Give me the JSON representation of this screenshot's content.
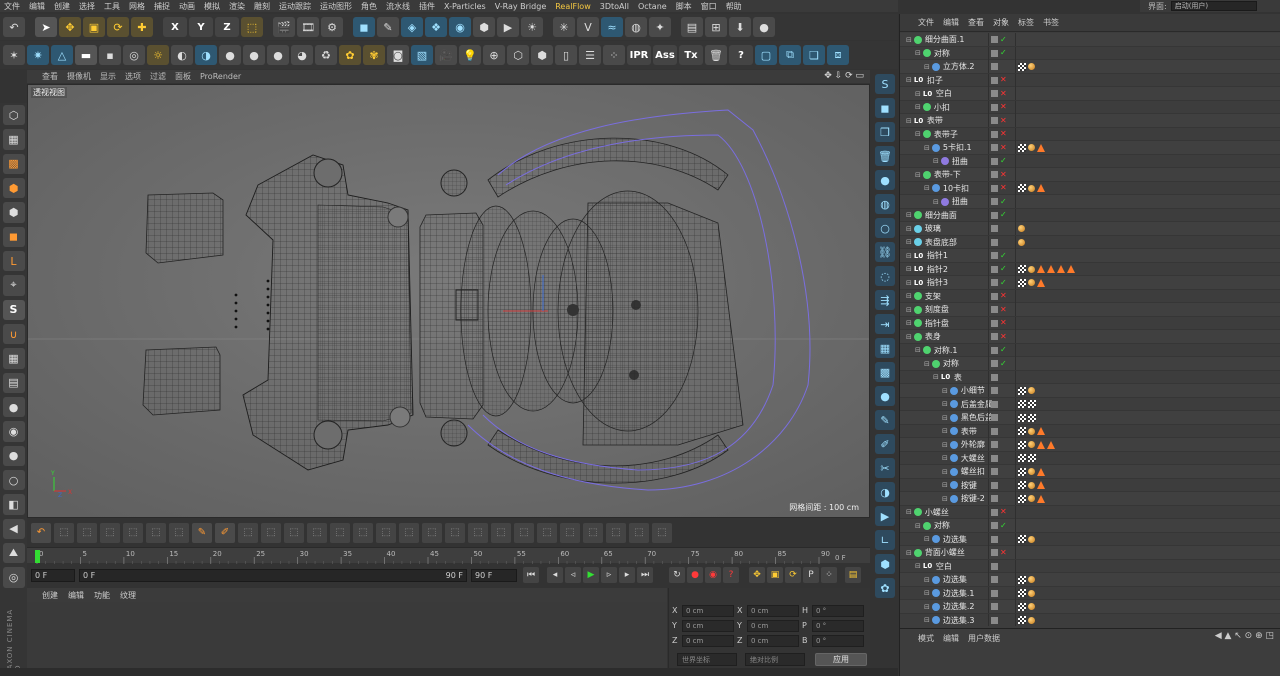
{
  "menubar": [
    "文件",
    "编辑",
    "创建",
    "选择",
    "工具",
    "网格",
    "捕捉",
    "动画",
    "模拟",
    "渲染",
    "雕刻",
    "运动跟踪",
    "运动图形",
    "角色",
    "流水线",
    "插件",
    "X-Particles",
    "V-Ray Bridge",
    "RealFlow",
    "3DtoAll",
    "Octane",
    "脚本",
    "窗口",
    "帮助"
  ],
  "layout": {
    "label": "界面:",
    "value": "启动(用户)"
  },
  "toolbar_top": {
    "icons": [
      "undo-icon",
      "arrow-icon",
      "move-icon",
      "scale-icon",
      "rotate-icon",
      "add-icon"
    ],
    "axis_labels": [
      "X",
      "Y",
      "Z"
    ]
  },
  "toolbar_second": {
    "text_buttons": [
      "IPR",
      "Ass",
      "Tx",
      "?"
    ]
  },
  "viewport": {
    "menu": [
      "查看",
      "摄像机",
      "显示",
      "选项",
      "过滤",
      "面板",
      "ProRender"
    ],
    "label": "透视视图",
    "grid_label": "网格间距 : 100 cm",
    "accent_wire": "#7a6ee0"
  },
  "timeline": {
    "ticks": [
      "0",
      "5",
      "10",
      "15",
      "20",
      "25",
      "30",
      "35",
      "40",
      "45",
      "50",
      "55",
      "60",
      "65",
      "70",
      "75",
      "80",
      "85",
      "90"
    ],
    "end_frame_label": "0 F",
    "current_start": "0 F",
    "range_start": "0 F",
    "range_end": "90 F",
    "end_field": "90 F"
  },
  "materials": {
    "menu": [
      "创建",
      "编辑",
      "功能",
      "纹理"
    ]
  },
  "coords": {
    "rows": [
      {
        "a": "X",
        "av": "0 cm",
        "b": "X",
        "bv": "0 cm",
        "c": "H",
        "cv": "0 °"
      },
      {
        "a": "Y",
        "av": "0 cm",
        "b": "Y",
        "bv": "0 cm",
        "c": "P",
        "cv": "0 °"
      },
      {
        "a": "Z",
        "av": "0 cm",
        "b": "Z",
        "bv": "0 cm",
        "c": "B",
        "cv": "0 °"
      }
    ],
    "mode": "世界坐标",
    "scale_mode": "绝对比例",
    "apply": "应用"
  },
  "objmanager": {
    "menu": [
      "文件",
      "编辑",
      "查看",
      "对象",
      "标签",
      "书签"
    ],
    "objects": [
      {
        "indent": 0,
        "name": "细分曲面.1",
        "icon": "green",
        "status": "ok",
        "tags": []
      },
      {
        "indent": 1,
        "name": "对称",
        "icon": "green",
        "status": "ok",
        "tags": []
      },
      {
        "indent": 2,
        "name": "立方体.2",
        "icon": "blue",
        "status": "none",
        "tags": [
          "chk",
          "dot"
        ]
      },
      {
        "indent": 0,
        "name": "扣子",
        "icon": "null",
        "status": "no",
        "tags": []
      },
      {
        "indent": 1,
        "name": "空白",
        "icon": "null",
        "status": "no",
        "tags": []
      },
      {
        "indent": 1,
        "name": "小扣",
        "icon": "green",
        "status": "no",
        "tags": []
      },
      {
        "indent": 0,
        "name": "表带",
        "icon": "null",
        "status": "no",
        "tags": []
      },
      {
        "indent": 1,
        "name": "表带子",
        "icon": "green",
        "status": "no",
        "tags": []
      },
      {
        "indent": 2,
        "name": "5卡扣.1",
        "icon": "blue",
        "status": "no",
        "tags": [
          "chk",
          "dot",
          "tri"
        ]
      },
      {
        "indent": 3,
        "name": "扭曲",
        "icon": "purple",
        "status": "ok",
        "tags": []
      },
      {
        "indent": 1,
        "name": "表带-下",
        "icon": "green",
        "status": "no",
        "tags": []
      },
      {
        "indent": 2,
        "name": "10卡扣",
        "icon": "blue",
        "status": "no",
        "tags": [
          "chk",
          "dot",
          "tri"
        ]
      },
      {
        "indent": 3,
        "name": "扭曲",
        "icon": "purple",
        "status": "ok",
        "tags": []
      },
      {
        "indent": 0,
        "name": "细分曲面",
        "icon": "green",
        "status": "ok",
        "tags": []
      },
      {
        "indent": 0,
        "name": "玻璃",
        "icon": "cyan",
        "status": "none",
        "tags": [
          "dot"
        ]
      },
      {
        "indent": 0,
        "name": "表盘底部",
        "icon": "cyan",
        "status": "none",
        "tags": [
          "dot"
        ]
      },
      {
        "indent": 0,
        "name": "指针1",
        "icon": "null",
        "status": "ok",
        "tags": []
      },
      {
        "indent": 0,
        "name": "指针2",
        "icon": "null",
        "status": "ok",
        "tags": [
          "chk",
          "dot",
          "tri",
          "tri",
          "tri",
          "tri"
        ]
      },
      {
        "indent": 0,
        "name": "指针3",
        "icon": "null",
        "status": "ok",
        "tags": [
          "chk",
          "dot",
          "tri"
        ]
      },
      {
        "indent": 0,
        "name": "支架",
        "icon": "green",
        "status": "no",
        "tags": []
      },
      {
        "indent": 0,
        "name": "刻度盘",
        "icon": "green",
        "status": "no",
        "tags": []
      },
      {
        "indent": 0,
        "name": "指针盘",
        "icon": "green",
        "status": "no",
        "tags": []
      },
      {
        "indent": 0,
        "name": "表身",
        "icon": "green",
        "status": "no",
        "tags": []
      },
      {
        "indent": 1,
        "name": "对称.1",
        "icon": "green",
        "status": "ok",
        "tags": []
      },
      {
        "indent": 2,
        "name": "对称",
        "icon": "green",
        "status": "ok",
        "tags": []
      },
      {
        "indent": 3,
        "name": "表",
        "icon": "null",
        "status": "none",
        "tags": []
      },
      {
        "indent": 4,
        "name": "小细节",
        "icon": "blue",
        "status": "none",
        "tags": [
          "chk",
          "dot"
        ]
      },
      {
        "indent": 4,
        "name": "后盖金属",
        "icon": "blue",
        "status": "none",
        "tags": [
          "chk",
          "chk"
        ]
      },
      {
        "indent": 4,
        "name": "黑色后盖",
        "icon": "blue",
        "status": "none",
        "tags": [
          "chk",
          "chk"
        ]
      },
      {
        "indent": 4,
        "name": "表带",
        "icon": "blue",
        "status": "none",
        "tags": [
          "chk",
          "dot",
          "tri"
        ]
      },
      {
        "indent": 4,
        "name": "外轮廓",
        "icon": "blue",
        "status": "none",
        "tags": [
          "chk",
          "dot",
          "tri",
          "tri"
        ]
      },
      {
        "indent": 4,
        "name": "大螺丝",
        "icon": "blue",
        "status": "none",
        "tags": [
          "chk",
          "chk"
        ]
      },
      {
        "indent": 4,
        "name": "螺丝扣",
        "icon": "blue",
        "status": "none",
        "tags": [
          "chk",
          "dot",
          "tri"
        ]
      },
      {
        "indent": 4,
        "name": "按键",
        "icon": "blue",
        "status": "none",
        "tags": [
          "chk",
          "dot",
          "tri"
        ]
      },
      {
        "indent": 4,
        "name": "按键-2",
        "icon": "blue",
        "status": "none",
        "tags": [
          "chk",
          "dot",
          "tri"
        ]
      },
      {
        "indent": 0,
        "name": "小螺丝",
        "icon": "green",
        "status": "no",
        "tags": []
      },
      {
        "indent": 1,
        "name": "对称",
        "icon": "green",
        "status": "ok",
        "tags": []
      },
      {
        "indent": 2,
        "name": "边选集",
        "icon": "blue",
        "status": "none",
        "tags": [
          "chk",
          "dot"
        ]
      },
      {
        "indent": 0,
        "name": "背面小螺丝",
        "icon": "green",
        "status": "no",
        "tags": []
      },
      {
        "indent": 1,
        "name": "空白",
        "icon": "null",
        "status": "none",
        "tags": []
      },
      {
        "indent": 2,
        "name": "边选集",
        "icon": "blue",
        "status": "none",
        "tags": [
          "chk",
          "dot"
        ]
      },
      {
        "indent": 2,
        "name": "边选集.1",
        "icon": "blue",
        "status": "none",
        "tags": [
          "chk",
          "dot"
        ]
      },
      {
        "indent": 2,
        "name": "边选集.2",
        "icon": "blue",
        "status": "none",
        "tags": [
          "chk",
          "dot"
        ]
      },
      {
        "indent": 2,
        "name": "边选集.3",
        "icon": "blue",
        "status": "none",
        "tags": [
          "chk",
          "dot"
        ]
      }
    ]
  },
  "attributes": {
    "menu": [
      "模式",
      "编辑",
      "用户数据"
    ]
  },
  "brand": "MAXON CINEMA 4D",
  "colors": {
    "accent": "#f5c842",
    "ok": "#33dd33",
    "no": "#ff3333",
    "tag_warn": "#ff7a2a"
  }
}
